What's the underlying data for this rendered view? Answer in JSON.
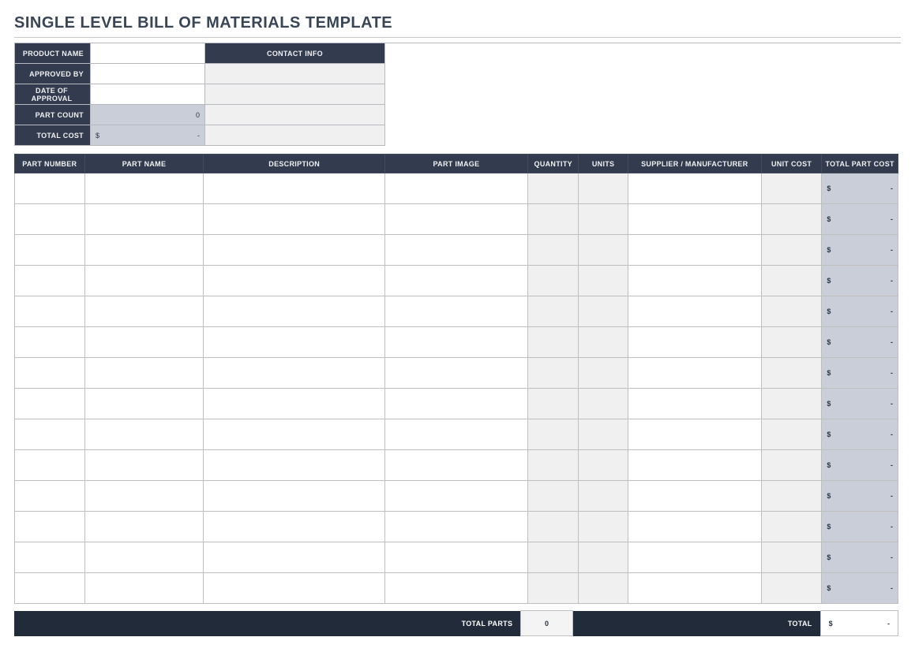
{
  "title": "SINGLE LEVEL BILL OF MATERIALS TEMPLATE",
  "info": {
    "product_name_label": "PRODUCT NAME",
    "product_name": "",
    "contact_info_label": "CONTACT INFO",
    "approved_by_label": "APPROVED BY",
    "approved_by": "",
    "contact_approved": "",
    "date_label": "DATE OF APPROVAL",
    "date": "",
    "contact_date": "",
    "part_count_label": "PART COUNT",
    "part_count": "0",
    "contact_count": "",
    "total_cost_label": "TOTAL COST",
    "total_cost_sym": "$",
    "total_cost_val": "-",
    "contact_total": ""
  },
  "columns": {
    "part_number": "PART NUMBER",
    "part_name": "PART NAME",
    "description": "DESCRIPTION",
    "part_image": "PART IMAGE",
    "quantity": "QUANTITY",
    "units": "UNITS",
    "supplier": "SUPPLIER / MANUFACTURER",
    "unit_cost": "UNIT COST",
    "total_part_cost": "TOTAL PART COST"
  },
  "row_cost": {
    "sym": "$",
    "val": "-"
  },
  "row_count": 14,
  "totals": {
    "parts_label": "TOTAL PARTS",
    "parts_value": "0",
    "total_label": "TOTAL",
    "total_sym": "$",
    "total_val": "-"
  }
}
